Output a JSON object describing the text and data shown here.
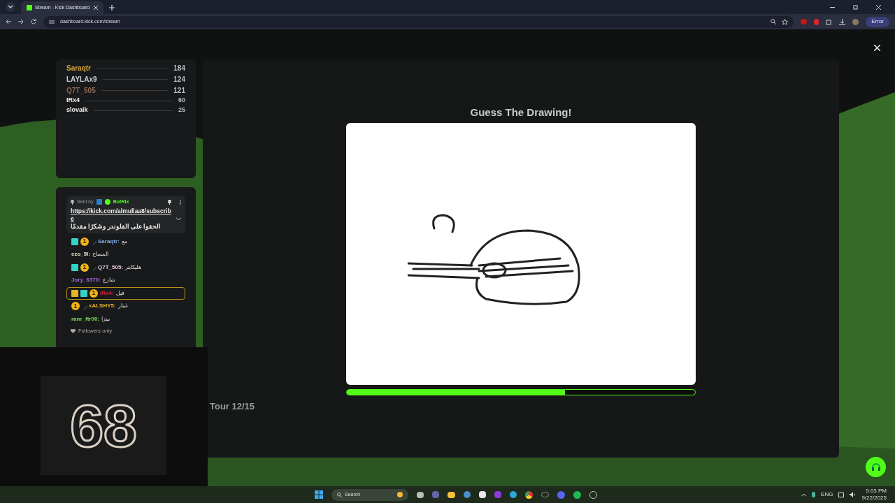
{
  "browser": {
    "tab": {
      "title": "Stream - Kick Dashboard"
    },
    "address": "dashboard.kick.com/stream",
    "profile": "Error"
  },
  "leaderboard": [
    {
      "name": "Saraqtr",
      "score": "184",
      "color": "#d4a53a",
      "kind": "top"
    },
    {
      "name": "LAYLAx9",
      "score": "124",
      "color": "#c9ccd6",
      "kind": "top"
    },
    {
      "name": "Q7T_505",
      "score": "121",
      "color": "#8a6a55",
      "kind": "top"
    },
    {
      "name": "IRx4",
      "score": "60",
      "color": "#f2f2f2",
      "kind": "rest"
    },
    {
      "name": "slovaik",
      "score": "25",
      "color": "#f2f2f2",
      "kind": "rest"
    }
  ],
  "chat": {
    "pinned": {
      "sent_by": "Sent by",
      "bot": "BotRix",
      "link": "https://kick.com/almullaa8/subscribe",
      "text": "الحقوا على الفلوندر وشكرًا مقدمًا"
    },
    "messages": [
      {
        "user": "Saraqtr:",
        "color": "#7fa8e0",
        "text": "مع",
        "highlighted": false,
        "badges": [
          {
            "kind": "sub"
          },
          {
            "kind": "tier",
            "label": "1"
          },
          {
            "kind": "sword"
          }
        ]
      },
      {
        "user": "ezo_5l:",
        "color": "#e8e0c8",
        "text": "المساح",
        "highlighted": false
      },
      {
        "user": "Q7T_505:",
        "color": "#e0c8d8",
        "text": "هليكابتر",
        "highlighted": false,
        "badges": [
          {
            "kind": "sub"
          },
          {
            "kind": "tier",
            "label": "1"
          },
          {
            "kind": "sword"
          }
        ]
      },
      {
        "user": "Jory_6370:",
        "color": "#a66ad8",
        "text": "شارع",
        "highlighted": false
      },
      {
        "user": "IRx4:",
        "color": "#d0243c",
        "text": "فيل",
        "highlighted": true,
        "badges": [
          {
            "kind": "crown"
          },
          {
            "kind": "sub"
          },
          {
            "kind": "tier",
            "label": "1"
          }
        ]
      },
      {
        "user": "xALSHY5:",
        "color": "#e6b422",
        "text": "غيتار",
        "highlighted": false,
        "badges": [
          {
            "kind": "tier",
            "label": "1"
          },
          {
            "kind": "sword"
          }
        ]
      },
      {
        "user": "ranr_ftr00:",
        "color": "#7ee05a",
        "text": "بيتزا",
        "highlighted": false
      }
    ],
    "mode": "Followers only"
  },
  "game": {
    "title": "Guess The Drawing!",
    "timer": {
      "level": 0.626
    },
    "round": "Tour 12/15"
  },
  "overlay": {
    "counter": "68"
  },
  "taskbar": {
    "search": "Search",
    "language": "ENG",
    "time": "5:03 PM",
    "date": "9/22/2025"
  }
}
